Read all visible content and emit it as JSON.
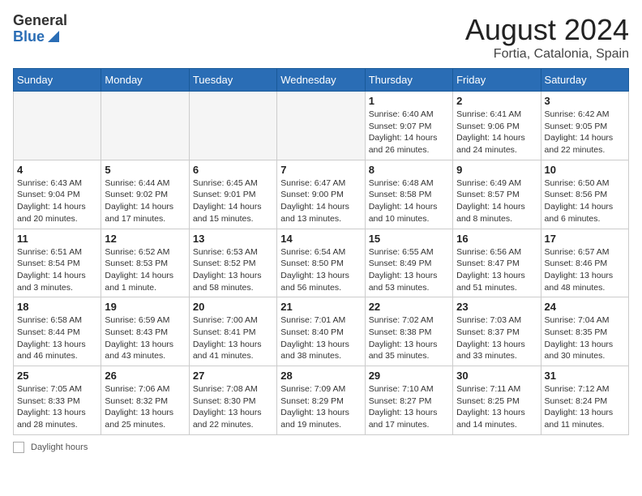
{
  "header": {
    "logo_general": "General",
    "logo_blue": "Blue",
    "title": "August 2024",
    "location": "Fortia, Catalonia, Spain"
  },
  "days_of_week": [
    "Sunday",
    "Monday",
    "Tuesday",
    "Wednesday",
    "Thursday",
    "Friday",
    "Saturday"
  ],
  "weeks": [
    [
      {
        "day": "",
        "info": ""
      },
      {
        "day": "",
        "info": ""
      },
      {
        "day": "",
        "info": ""
      },
      {
        "day": "",
        "info": ""
      },
      {
        "day": "1",
        "info": "Sunrise: 6:40 AM\nSunset: 9:07 PM\nDaylight: 14 hours and 26 minutes."
      },
      {
        "day": "2",
        "info": "Sunrise: 6:41 AM\nSunset: 9:06 PM\nDaylight: 14 hours and 24 minutes."
      },
      {
        "day": "3",
        "info": "Sunrise: 6:42 AM\nSunset: 9:05 PM\nDaylight: 14 hours and 22 minutes."
      }
    ],
    [
      {
        "day": "4",
        "info": "Sunrise: 6:43 AM\nSunset: 9:04 PM\nDaylight: 14 hours and 20 minutes."
      },
      {
        "day": "5",
        "info": "Sunrise: 6:44 AM\nSunset: 9:02 PM\nDaylight: 14 hours and 17 minutes."
      },
      {
        "day": "6",
        "info": "Sunrise: 6:45 AM\nSunset: 9:01 PM\nDaylight: 14 hours and 15 minutes."
      },
      {
        "day": "7",
        "info": "Sunrise: 6:47 AM\nSunset: 9:00 PM\nDaylight: 14 hours and 13 minutes."
      },
      {
        "day": "8",
        "info": "Sunrise: 6:48 AM\nSunset: 8:58 PM\nDaylight: 14 hours and 10 minutes."
      },
      {
        "day": "9",
        "info": "Sunrise: 6:49 AM\nSunset: 8:57 PM\nDaylight: 14 hours and 8 minutes."
      },
      {
        "day": "10",
        "info": "Sunrise: 6:50 AM\nSunset: 8:56 PM\nDaylight: 14 hours and 6 minutes."
      }
    ],
    [
      {
        "day": "11",
        "info": "Sunrise: 6:51 AM\nSunset: 8:54 PM\nDaylight: 14 hours and 3 minutes."
      },
      {
        "day": "12",
        "info": "Sunrise: 6:52 AM\nSunset: 8:53 PM\nDaylight: 14 hours and 1 minute."
      },
      {
        "day": "13",
        "info": "Sunrise: 6:53 AM\nSunset: 8:52 PM\nDaylight: 13 hours and 58 minutes."
      },
      {
        "day": "14",
        "info": "Sunrise: 6:54 AM\nSunset: 8:50 PM\nDaylight: 13 hours and 56 minutes."
      },
      {
        "day": "15",
        "info": "Sunrise: 6:55 AM\nSunset: 8:49 PM\nDaylight: 13 hours and 53 minutes."
      },
      {
        "day": "16",
        "info": "Sunrise: 6:56 AM\nSunset: 8:47 PM\nDaylight: 13 hours and 51 minutes."
      },
      {
        "day": "17",
        "info": "Sunrise: 6:57 AM\nSunset: 8:46 PM\nDaylight: 13 hours and 48 minutes."
      }
    ],
    [
      {
        "day": "18",
        "info": "Sunrise: 6:58 AM\nSunset: 8:44 PM\nDaylight: 13 hours and 46 minutes."
      },
      {
        "day": "19",
        "info": "Sunrise: 6:59 AM\nSunset: 8:43 PM\nDaylight: 13 hours and 43 minutes."
      },
      {
        "day": "20",
        "info": "Sunrise: 7:00 AM\nSunset: 8:41 PM\nDaylight: 13 hours and 41 minutes."
      },
      {
        "day": "21",
        "info": "Sunrise: 7:01 AM\nSunset: 8:40 PM\nDaylight: 13 hours and 38 minutes."
      },
      {
        "day": "22",
        "info": "Sunrise: 7:02 AM\nSunset: 8:38 PM\nDaylight: 13 hours and 35 minutes."
      },
      {
        "day": "23",
        "info": "Sunrise: 7:03 AM\nSunset: 8:37 PM\nDaylight: 13 hours and 33 minutes."
      },
      {
        "day": "24",
        "info": "Sunrise: 7:04 AM\nSunset: 8:35 PM\nDaylight: 13 hours and 30 minutes."
      }
    ],
    [
      {
        "day": "25",
        "info": "Sunrise: 7:05 AM\nSunset: 8:33 PM\nDaylight: 13 hours and 28 minutes."
      },
      {
        "day": "26",
        "info": "Sunrise: 7:06 AM\nSunset: 8:32 PM\nDaylight: 13 hours and 25 minutes."
      },
      {
        "day": "27",
        "info": "Sunrise: 7:08 AM\nSunset: 8:30 PM\nDaylight: 13 hours and 22 minutes."
      },
      {
        "day": "28",
        "info": "Sunrise: 7:09 AM\nSunset: 8:29 PM\nDaylight: 13 hours and 19 minutes."
      },
      {
        "day": "29",
        "info": "Sunrise: 7:10 AM\nSunset: 8:27 PM\nDaylight: 13 hours and 17 minutes."
      },
      {
        "day": "30",
        "info": "Sunrise: 7:11 AM\nSunset: 8:25 PM\nDaylight: 13 hours and 14 minutes."
      },
      {
        "day": "31",
        "info": "Sunrise: 7:12 AM\nSunset: 8:24 PM\nDaylight: 13 hours and 11 minutes."
      }
    ]
  ],
  "footer": {
    "label": "Daylight hours"
  }
}
